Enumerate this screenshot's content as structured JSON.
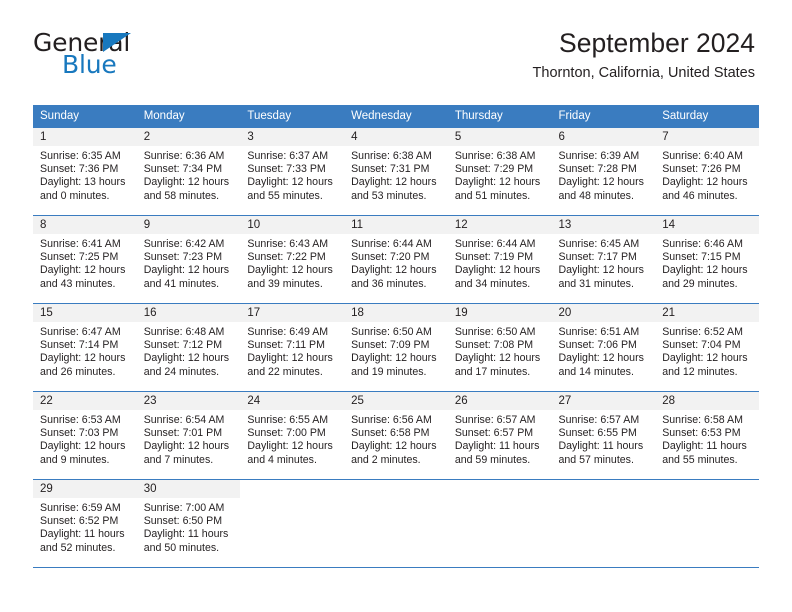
{
  "brand": {
    "name_part1": "General",
    "name_part2": "Blue",
    "accent_color": "#1878be"
  },
  "header": {
    "title": "September 2024",
    "subtitle": "Thornton, California, United States"
  },
  "theme": {
    "header_bg": "#3a7cc0",
    "daynum_bg": "#f2f2f2",
    "text": "#231f20"
  },
  "calendar": {
    "weekday_headers": [
      "Sunday",
      "Monday",
      "Tuesday",
      "Wednesday",
      "Thursday",
      "Friday",
      "Saturday"
    ],
    "weeks": [
      [
        {
          "day": "1",
          "sunrise": "Sunrise: 6:35 AM",
          "sunset": "Sunset: 7:36 PM",
          "daylight1": "Daylight: 13 hours",
          "daylight2": "and 0 minutes."
        },
        {
          "day": "2",
          "sunrise": "Sunrise: 6:36 AM",
          "sunset": "Sunset: 7:34 PM",
          "daylight1": "Daylight: 12 hours",
          "daylight2": "and 58 minutes."
        },
        {
          "day": "3",
          "sunrise": "Sunrise: 6:37 AM",
          "sunset": "Sunset: 7:33 PM",
          "daylight1": "Daylight: 12 hours",
          "daylight2": "and 55 minutes."
        },
        {
          "day": "4",
          "sunrise": "Sunrise: 6:38 AM",
          "sunset": "Sunset: 7:31 PM",
          "daylight1": "Daylight: 12 hours",
          "daylight2": "and 53 minutes."
        },
        {
          "day": "5",
          "sunrise": "Sunrise: 6:38 AM",
          "sunset": "Sunset: 7:29 PM",
          "daylight1": "Daylight: 12 hours",
          "daylight2": "and 51 minutes."
        },
        {
          "day": "6",
          "sunrise": "Sunrise: 6:39 AM",
          "sunset": "Sunset: 7:28 PM",
          "daylight1": "Daylight: 12 hours",
          "daylight2": "and 48 minutes."
        },
        {
          "day": "7",
          "sunrise": "Sunrise: 6:40 AM",
          "sunset": "Sunset: 7:26 PM",
          "daylight1": "Daylight: 12 hours",
          "daylight2": "and 46 minutes."
        }
      ],
      [
        {
          "day": "8",
          "sunrise": "Sunrise: 6:41 AM",
          "sunset": "Sunset: 7:25 PM",
          "daylight1": "Daylight: 12 hours",
          "daylight2": "and 43 minutes."
        },
        {
          "day": "9",
          "sunrise": "Sunrise: 6:42 AM",
          "sunset": "Sunset: 7:23 PM",
          "daylight1": "Daylight: 12 hours",
          "daylight2": "and 41 minutes."
        },
        {
          "day": "10",
          "sunrise": "Sunrise: 6:43 AM",
          "sunset": "Sunset: 7:22 PM",
          "daylight1": "Daylight: 12 hours",
          "daylight2": "and 39 minutes."
        },
        {
          "day": "11",
          "sunrise": "Sunrise: 6:44 AM",
          "sunset": "Sunset: 7:20 PM",
          "daylight1": "Daylight: 12 hours",
          "daylight2": "and 36 minutes."
        },
        {
          "day": "12",
          "sunrise": "Sunrise: 6:44 AM",
          "sunset": "Sunset: 7:19 PM",
          "daylight1": "Daylight: 12 hours",
          "daylight2": "and 34 minutes."
        },
        {
          "day": "13",
          "sunrise": "Sunrise: 6:45 AM",
          "sunset": "Sunset: 7:17 PM",
          "daylight1": "Daylight: 12 hours",
          "daylight2": "and 31 minutes."
        },
        {
          "day": "14",
          "sunrise": "Sunrise: 6:46 AM",
          "sunset": "Sunset: 7:15 PM",
          "daylight1": "Daylight: 12 hours",
          "daylight2": "and 29 minutes."
        }
      ],
      [
        {
          "day": "15",
          "sunrise": "Sunrise: 6:47 AM",
          "sunset": "Sunset: 7:14 PM",
          "daylight1": "Daylight: 12 hours",
          "daylight2": "and 26 minutes."
        },
        {
          "day": "16",
          "sunrise": "Sunrise: 6:48 AM",
          "sunset": "Sunset: 7:12 PM",
          "daylight1": "Daylight: 12 hours",
          "daylight2": "and 24 minutes."
        },
        {
          "day": "17",
          "sunrise": "Sunrise: 6:49 AM",
          "sunset": "Sunset: 7:11 PM",
          "daylight1": "Daylight: 12 hours",
          "daylight2": "and 22 minutes."
        },
        {
          "day": "18",
          "sunrise": "Sunrise: 6:50 AM",
          "sunset": "Sunset: 7:09 PM",
          "daylight1": "Daylight: 12 hours",
          "daylight2": "and 19 minutes."
        },
        {
          "day": "19",
          "sunrise": "Sunrise: 6:50 AM",
          "sunset": "Sunset: 7:08 PM",
          "daylight1": "Daylight: 12 hours",
          "daylight2": "and 17 minutes."
        },
        {
          "day": "20",
          "sunrise": "Sunrise: 6:51 AM",
          "sunset": "Sunset: 7:06 PM",
          "daylight1": "Daylight: 12 hours",
          "daylight2": "and 14 minutes."
        },
        {
          "day": "21",
          "sunrise": "Sunrise: 6:52 AM",
          "sunset": "Sunset: 7:04 PM",
          "daylight1": "Daylight: 12 hours",
          "daylight2": "and 12 minutes."
        }
      ],
      [
        {
          "day": "22",
          "sunrise": "Sunrise: 6:53 AM",
          "sunset": "Sunset: 7:03 PM",
          "daylight1": "Daylight: 12 hours",
          "daylight2": "and 9 minutes."
        },
        {
          "day": "23",
          "sunrise": "Sunrise: 6:54 AM",
          "sunset": "Sunset: 7:01 PM",
          "daylight1": "Daylight: 12 hours",
          "daylight2": "and 7 minutes."
        },
        {
          "day": "24",
          "sunrise": "Sunrise: 6:55 AM",
          "sunset": "Sunset: 7:00 PM",
          "daylight1": "Daylight: 12 hours",
          "daylight2": "and 4 minutes."
        },
        {
          "day": "25",
          "sunrise": "Sunrise: 6:56 AM",
          "sunset": "Sunset: 6:58 PM",
          "daylight1": "Daylight: 12 hours",
          "daylight2": "and 2 minutes."
        },
        {
          "day": "26",
          "sunrise": "Sunrise: 6:57 AM",
          "sunset": "Sunset: 6:57 PM",
          "daylight1": "Daylight: 11 hours",
          "daylight2": "and 59 minutes."
        },
        {
          "day": "27",
          "sunrise": "Sunrise: 6:57 AM",
          "sunset": "Sunset: 6:55 PM",
          "daylight1": "Daylight: 11 hours",
          "daylight2": "and 57 minutes."
        },
        {
          "day": "28",
          "sunrise": "Sunrise: 6:58 AM",
          "sunset": "Sunset: 6:53 PM",
          "daylight1": "Daylight: 11 hours",
          "daylight2": "and 55 minutes."
        }
      ],
      [
        {
          "day": "29",
          "sunrise": "Sunrise: 6:59 AM",
          "sunset": "Sunset: 6:52 PM",
          "daylight1": "Daylight: 11 hours",
          "daylight2": "and 52 minutes."
        },
        {
          "day": "30",
          "sunrise": "Sunrise: 7:00 AM",
          "sunset": "Sunset: 6:50 PM",
          "daylight1": "Daylight: 11 hours",
          "daylight2": "and 50 minutes."
        },
        {
          "day": "",
          "sunrise": "",
          "sunset": "",
          "daylight1": "",
          "daylight2": ""
        },
        {
          "day": "",
          "sunrise": "",
          "sunset": "",
          "daylight1": "",
          "daylight2": ""
        },
        {
          "day": "",
          "sunrise": "",
          "sunset": "",
          "daylight1": "",
          "daylight2": ""
        },
        {
          "day": "",
          "sunrise": "",
          "sunset": "",
          "daylight1": "",
          "daylight2": ""
        },
        {
          "day": "",
          "sunrise": "",
          "sunset": "",
          "daylight1": "",
          "daylight2": ""
        }
      ]
    ]
  }
}
